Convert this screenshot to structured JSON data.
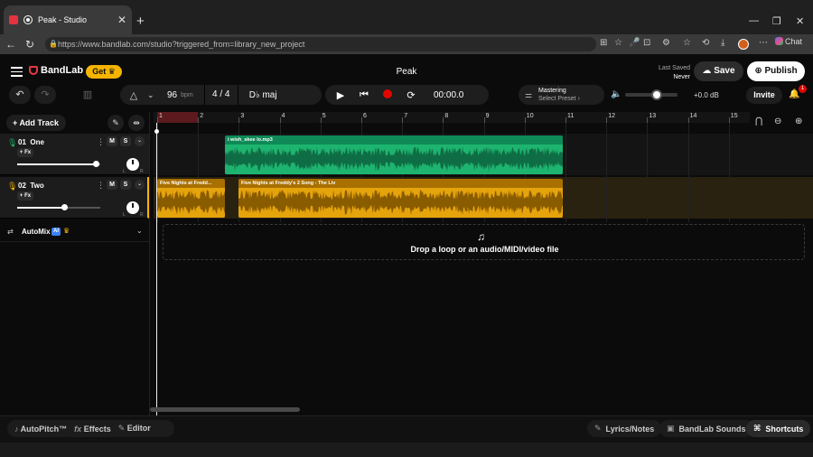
{
  "browser": {
    "tab_title": "Peak - Studio",
    "url": "https://www.bandlab.com/studio?triggered_from=library_new_project",
    "chat_label": "Chat"
  },
  "header": {
    "brand": "BandLab",
    "get_label": "Get",
    "project_title": "Peak",
    "last_saved_label": "Last Saved",
    "last_saved_value": "Never",
    "save_label": "Save",
    "publish_label": "Publish"
  },
  "transport": {
    "tempo": "96",
    "tempo_unit": "bpm",
    "time_signature": "4 / 4",
    "key": "D♭ maj",
    "time": "00:00.0",
    "mastering_title": "Mastering",
    "mastering_preset": "Select Preset",
    "volume_db": "+0.0 dB",
    "volume_level": 0.6,
    "invite_label": "Invite",
    "notifications_count": "1"
  },
  "tracks_panel": {
    "add_track_label": "Add Track",
    "tracks": [
      {
        "number": "01",
        "name": "One",
        "fx": "+ Fx",
        "mute": "M",
        "solo": "S",
        "volume": 0.95
      },
      {
        "number": "02",
        "name": "Two",
        "fx": "+ Fx",
        "mute": "M",
        "solo": "S",
        "volume": 0.57
      }
    ],
    "automix_label": "AutoMix",
    "ai_badge": "AI"
  },
  "timeline": {
    "bars": [
      "1",
      "2",
      "3",
      "4",
      "5",
      "6",
      "7",
      "8",
      "9",
      "10",
      "11",
      "12",
      "13",
      "14",
      "15"
    ],
    "clips": {
      "track1": "i wish_skee lo.mp3",
      "track2a": "Five Nights at Fredd...",
      "track2b": "Five Nights at Freddy's 2 Song - The Liv"
    },
    "drop_text": "Drop a loop or an audio/MIDI/video file"
  },
  "bottom": {
    "autopitch": "AutoPitch™",
    "effects": "Effects",
    "editor": "Editor",
    "lyrics": "Lyrics/Notes",
    "sounds": "BandLab Sounds",
    "shortcuts": "Shortcuts"
  },
  "colors": {
    "accent_gold": "#f5b400",
    "track1_clip": "#1db46f",
    "track2_clip": "#e5a30c",
    "record": "#e10600"
  }
}
